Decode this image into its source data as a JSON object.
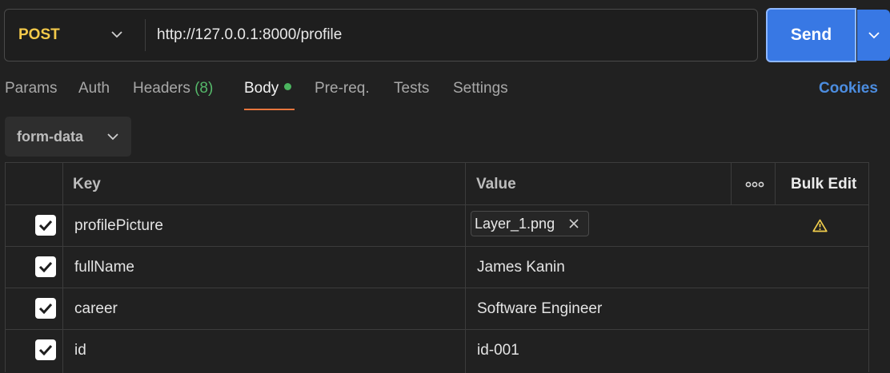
{
  "request": {
    "method": "POST",
    "url": "http://127.0.0.1:8000/profile",
    "send_label": "Send"
  },
  "tabs": {
    "params": "Params",
    "auth": "Auth",
    "headers": "Headers",
    "headers_count": "(8)",
    "body": "Body",
    "prereq": "Pre-req.",
    "tests": "Tests",
    "settings": "Settings",
    "cookies": "Cookies",
    "active": "Body"
  },
  "body": {
    "type": "form-data"
  },
  "table": {
    "headers": {
      "key": "Key",
      "value": "Value",
      "bulk_edit": "Bulk Edit"
    },
    "rows": [
      {
        "checked": true,
        "key": "profilePicture",
        "value_type": "file",
        "value": "Layer_1.png",
        "warning": true
      },
      {
        "checked": true,
        "key": "fullName",
        "value_type": "text",
        "value": "James Kanin"
      },
      {
        "checked": true,
        "key": "career",
        "value_type": "text",
        "value": "Software Engineer"
      },
      {
        "checked": true,
        "key": "id",
        "value_type": "text",
        "value": "id-001"
      }
    ]
  },
  "icons": {
    "method_dropdown": "chevron-down-icon",
    "send_dropdown": "chevron-down-icon",
    "body_type_dropdown": "chevron-down-icon",
    "more": "more-horizontal-icon",
    "checkbox": "checkmark-icon",
    "remove_file": "close-icon",
    "warning": "warning-triangle-icon"
  },
  "colors": {
    "background": "#212121",
    "method": "#f3c94a",
    "send": "#3878e4",
    "link": "#4c8de0",
    "active_tab_underline": "#e8763d",
    "status_dot": "#4bb55f",
    "warning": "#f2cf4c"
  }
}
